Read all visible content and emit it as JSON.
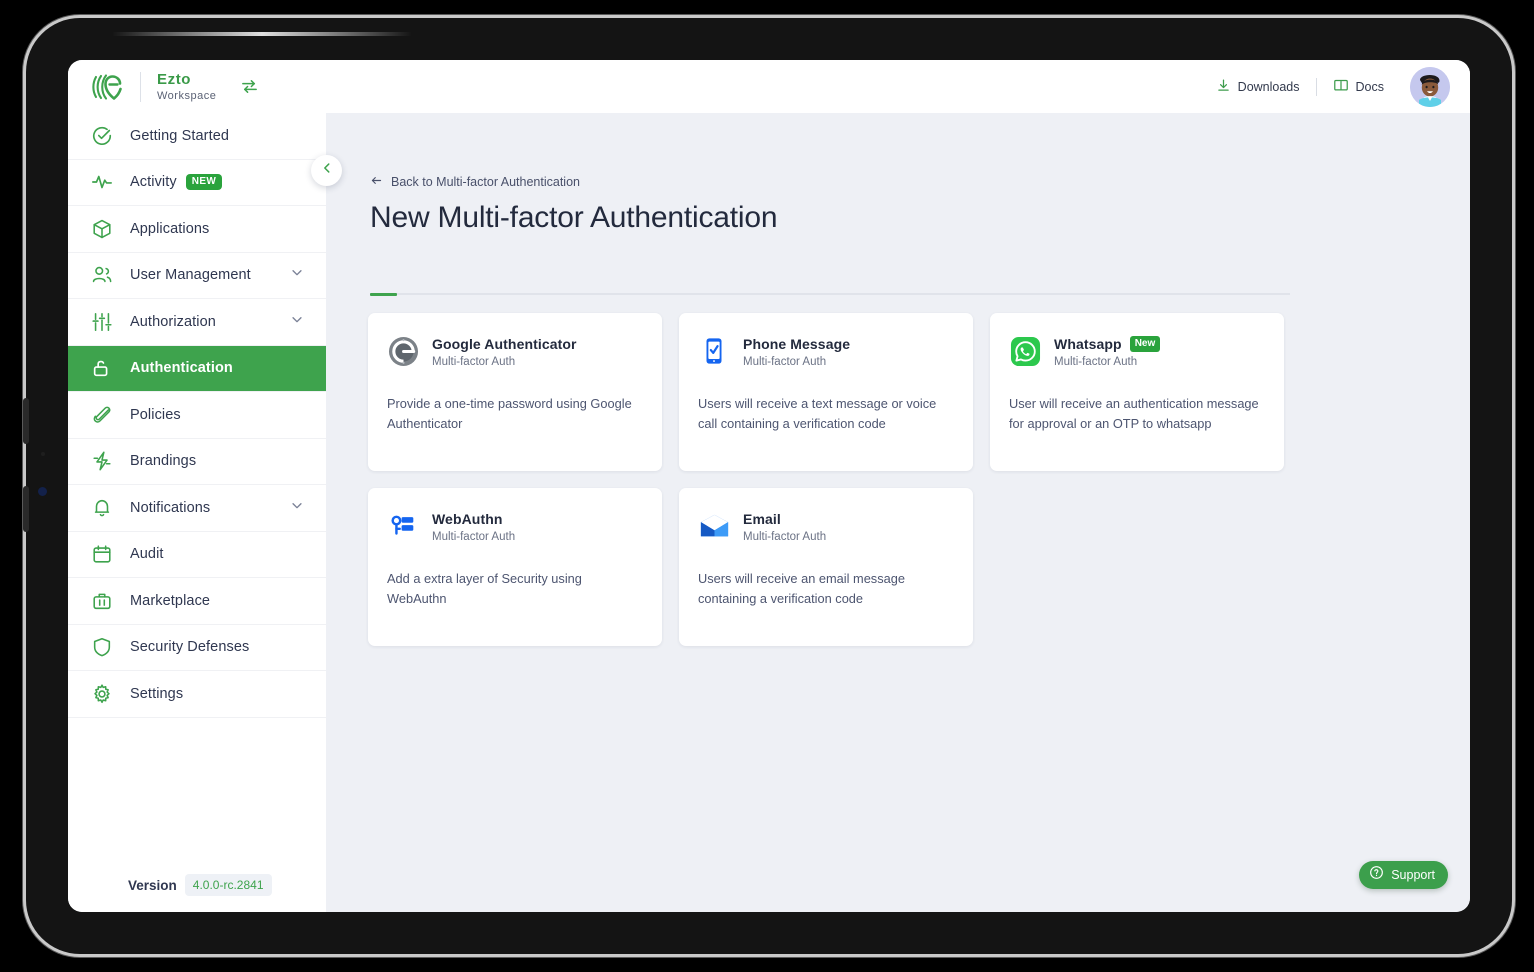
{
  "brand": {
    "name": "Ezto",
    "subtitle": "Workspace",
    "logo_icon": "ezto-logo-icon",
    "switch_icon": "switch-workspace-icon",
    "accent_color": "#3ea34d"
  },
  "topbar": {
    "downloads_label": "Downloads",
    "downloads_icon": "download-icon",
    "docs_label": "Docs",
    "docs_icon": "book-icon",
    "avatar_icon": "user-avatar"
  },
  "sidebar": {
    "collapse_icon": "chevron-left-icon",
    "items": [
      {
        "label": "Getting Started",
        "icon": "check-circle-icon",
        "active": false,
        "badge": null,
        "expandable": false
      },
      {
        "label": "Activity",
        "icon": "activity-pulse-icon",
        "active": false,
        "badge": "NEW",
        "expandable": false
      },
      {
        "label": "Applications",
        "icon": "box-icon",
        "active": false,
        "badge": null,
        "expandable": false
      },
      {
        "label": "User Management",
        "icon": "users-icon",
        "active": false,
        "badge": null,
        "expandable": true
      },
      {
        "label": "Authorization",
        "icon": "sliders-icon",
        "active": false,
        "badge": null,
        "expandable": true
      },
      {
        "label": "Authentication",
        "icon": "unlock-icon",
        "active": true,
        "badge": null,
        "expandable": false
      },
      {
        "label": "Policies",
        "icon": "paperclip-icon",
        "active": false,
        "badge": null,
        "expandable": false
      },
      {
        "label": "Brandings",
        "icon": "lightning-icon",
        "active": false,
        "badge": null,
        "expandable": false
      },
      {
        "label": "Notifications",
        "icon": "bell-icon",
        "active": false,
        "badge": null,
        "expandable": true
      },
      {
        "label": "Audit",
        "icon": "calendar-icon",
        "active": false,
        "badge": null,
        "expandable": false
      },
      {
        "label": "Marketplace",
        "icon": "briefcase-icon",
        "active": false,
        "badge": null,
        "expandable": false
      },
      {
        "label": "Security Defenses",
        "icon": "shield-icon",
        "active": false,
        "badge": null,
        "expandable": false
      },
      {
        "label": "Settings",
        "icon": "gear-icon",
        "active": false,
        "badge": null,
        "expandable": false
      }
    ],
    "version_label": "Version",
    "version_value": "4.0.0-rc.2841"
  },
  "main": {
    "back_link": "Back to Multi-factor Authentication",
    "back_icon": "arrow-left-icon",
    "title": "New Multi-factor Authentication",
    "cards": [
      {
        "title": "Google Authenticator",
        "badge": null,
        "subtitle": "Multi-factor Auth",
        "description": "Provide a one-time password using Google Authenticator",
        "icon": "google-authenticator-icon"
      },
      {
        "title": "Phone Message",
        "badge": null,
        "subtitle": "Multi-factor Auth",
        "description": "Users will receive a text message or voice call containing a verification code",
        "icon": "phone-check-icon"
      },
      {
        "title": "Whatsapp",
        "badge": "New",
        "subtitle": "Multi-factor Auth",
        "description": "User will receive an authentication message for approval or an OTP to whatsapp",
        "icon": "whatsapp-icon"
      },
      {
        "title": "WebAuthn",
        "badge": null,
        "subtitle": "Multi-factor Auth",
        "description": "Add a extra layer of Security using WebAuthn",
        "icon": "webauthn-key-icon"
      },
      {
        "title": "Email",
        "badge": null,
        "subtitle": "Multi-factor Auth",
        "description": "Users will receive an email message containing a verification code",
        "icon": "envelope-icon"
      }
    ]
  },
  "support": {
    "label": "Support",
    "icon": "question-circle-icon"
  }
}
